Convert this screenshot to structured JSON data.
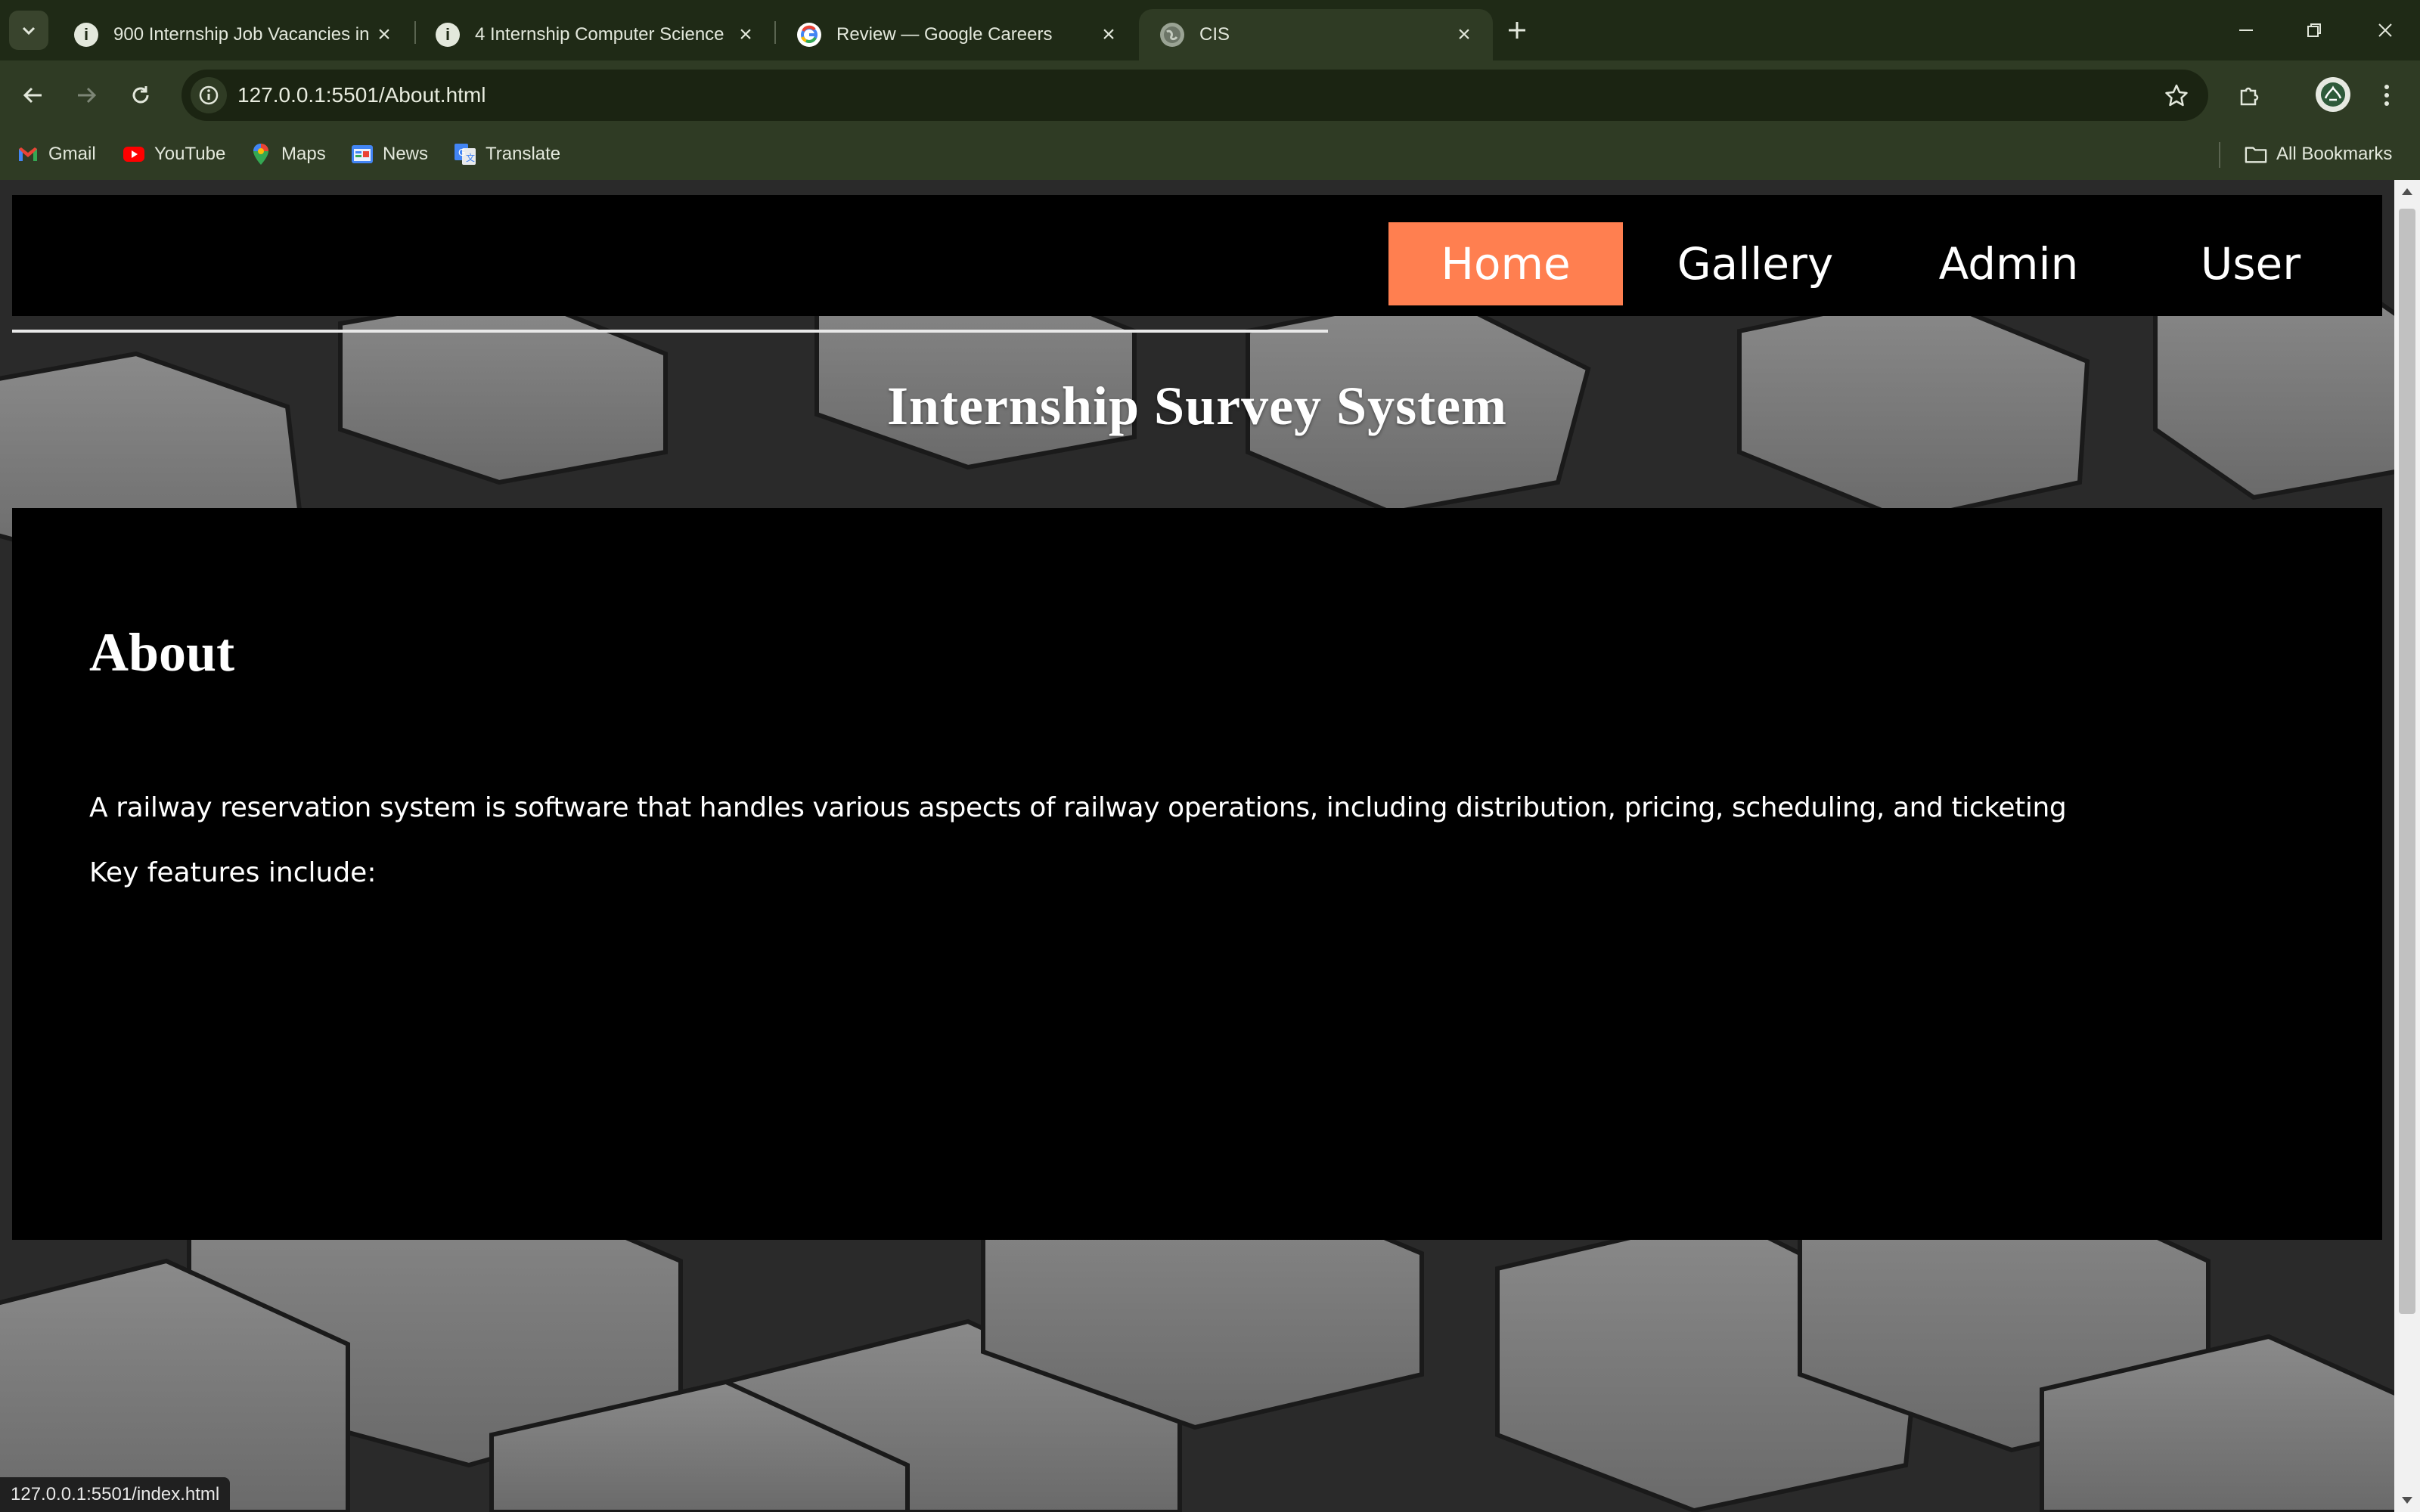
{
  "browser": {
    "tabs": [
      {
        "title": "900 Internship Job Vacancies in",
        "icon": "info-icon",
        "active": false
      },
      {
        "title": "4 Internship Computer Science",
        "icon": "info-icon",
        "active": false
      },
      {
        "title": "Review — Google Careers",
        "icon": "google-icon",
        "active": false
      },
      {
        "title": "CIS",
        "icon": "globe-icon",
        "active": true
      }
    ],
    "url": "127.0.0.1:5501/About.html",
    "bookmarks": [
      {
        "label": "Gmail",
        "icon": "gmail-icon"
      },
      {
        "label": "YouTube",
        "icon": "youtube-icon"
      },
      {
        "label": "Maps",
        "icon": "maps-icon"
      },
      {
        "label": "News",
        "icon": "news-icon"
      },
      {
        "label": "Translate",
        "icon": "translate-icon"
      }
    ],
    "all_bookmarks_label": "All Bookmarks",
    "status_url": "127.0.0.1:5501/index.html"
  },
  "site": {
    "nav": [
      {
        "label": "Home",
        "active": true
      },
      {
        "label": "Gallery",
        "active": false
      },
      {
        "label": "Admin",
        "active": false
      },
      {
        "label": "User",
        "active": false
      }
    ],
    "title": "Internship Survey System"
  },
  "about": {
    "heading": "About",
    "paragraph": "A railway reservation system is software that handles various aspects of railway operations, including distribution, pricing, scheduling, and ticketing",
    "features_intro": "Key features include:"
  },
  "colors": {
    "accent": "#ff7f50",
    "chrome": "#2f3b24",
    "tabstrip": "#1f2a16"
  }
}
